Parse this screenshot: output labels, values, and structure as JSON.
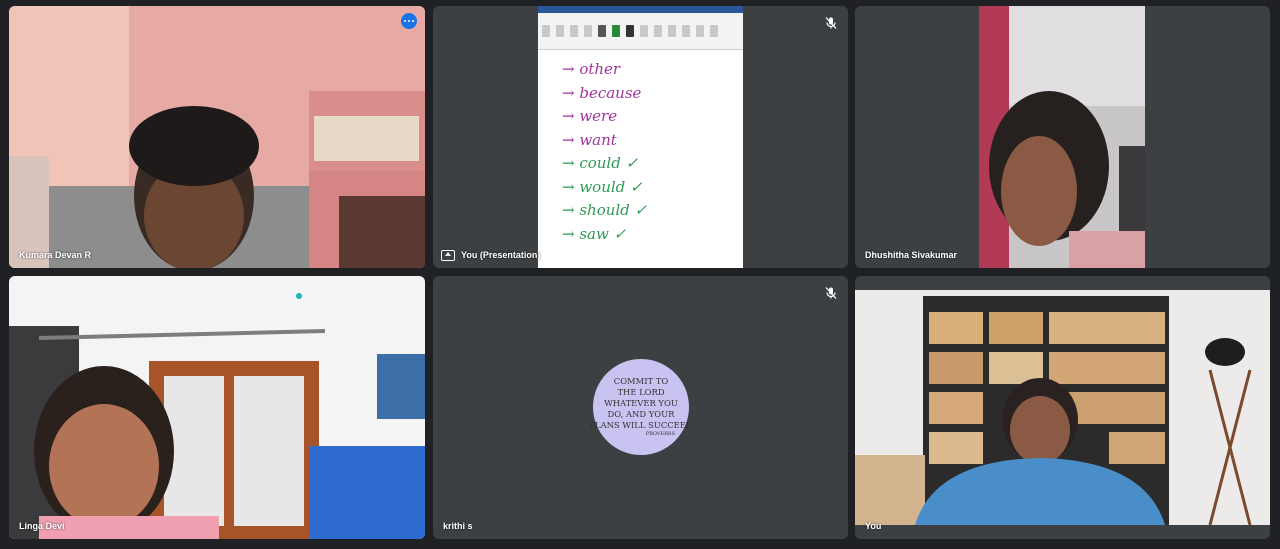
{
  "tiles": {
    "kumara": {
      "name": "Kumara Devan R"
    },
    "presentation": {
      "name": "You (Presentation)"
    },
    "dhushitha": {
      "name": "Dhushitha Sivakumar"
    },
    "linga": {
      "name": "Linga Devi"
    },
    "krithi": {
      "name": "krithi s"
    },
    "you": {
      "name": "You"
    }
  },
  "document": {
    "words": [
      {
        "text": "→ other",
        "color": "purple"
      },
      {
        "text": "→ because",
        "color": "purple"
      },
      {
        "text": "→ were",
        "color": "purple"
      },
      {
        "text": "→ want",
        "color": "purple"
      },
      {
        "text": "→ could ✓",
        "color": "green"
      },
      {
        "text": "→ would ✓",
        "color": "green"
      },
      {
        "text": "→ should ✓",
        "color": "green"
      },
      {
        "text": "→ saw ✓",
        "color": "green"
      }
    ]
  },
  "krithi_avatar": {
    "lines": [
      "COMMIT TO",
      "THE LORD",
      "WHATEVER YOU",
      "DO, AND YOUR",
      "PLANS WILL SUCCEED"
    ],
    "source": "PROVERBS"
  },
  "colors": {
    "background": "#202124",
    "tile": "#3c4043",
    "accent": "#1a73e8",
    "active_outline": "#8ab4f8"
  }
}
